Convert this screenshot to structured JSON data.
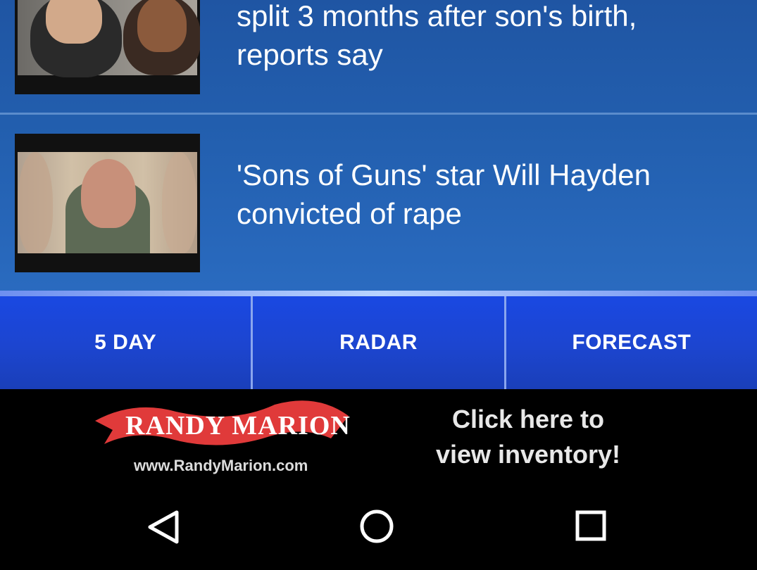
{
  "news": {
    "items": [
      {
        "headline": "split 3 months after son's birth, reports say",
        "thumb_icon": "news-photo"
      },
      {
        "headline": "'Sons of Guns' star Will Hayden convicted of rape",
        "thumb_icon": "news-photo"
      }
    ]
  },
  "tabs": [
    {
      "label": "5 DAY"
    },
    {
      "label": "RADAR"
    },
    {
      "label": "FORECAST"
    }
  ],
  "ad": {
    "logo_text": "RANDY MARION",
    "url": "www.RandyMarion.com",
    "cta": "Click here to view inventory!",
    "brand_color": "#e03a3a"
  },
  "navbar": {
    "back_icon": "back-triangle-icon",
    "home_icon": "home-circle-icon",
    "recent_icon": "recent-apps-square-icon"
  }
}
